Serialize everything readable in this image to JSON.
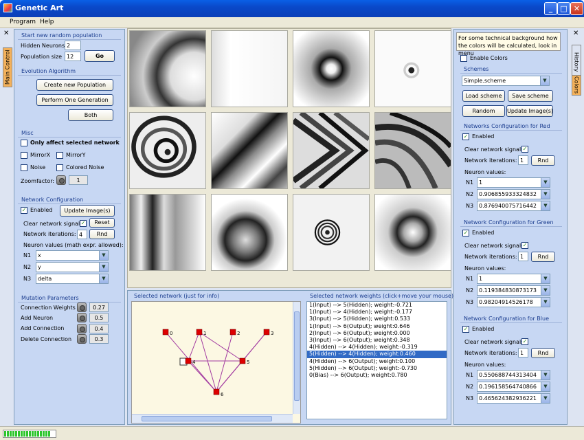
{
  "window": {
    "title": "Genetic Art",
    "min": "_",
    "max": "□",
    "close": "✕"
  },
  "menu": [
    "Program",
    "Help"
  ],
  "left_tabs": {
    "close": "✕",
    "main": "Main Control"
  },
  "right_tabs": {
    "close": "✕",
    "history": "History",
    "colors": "Colors"
  },
  "random_pop": {
    "title": "Start new random population",
    "hidden_label": "Hidden Neurons",
    "hidden_value": "2",
    "size_label": "Population size",
    "size_value": "12",
    "go": "Go"
  },
  "evolution": {
    "title": "Evolution Algorithm",
    "create": "Create new Population",
    "perform": "Perform One Generation",
    "both": "Both"
  },
  "misc": {
    "title": "Misc",
    "only_affect": "Only affect selected network",
    "mirrorx": "MirrorX",
    "mirrory": "MirrorY",
    "noise": "Noise",
    "colored_noise": "Colored Noise",
    "zoom_label": "Zoomfactor:",
    "zoom_value": "1"
  },
  "netconf": {
    "title": "Network Configuration",
    "enabled": "Enabled",
    "update": "Update Image(s)",
    "clear": "Clear network signals",
    "reset": "Reset",
    "iter_label": "Network iterations:",
    "iter_value": "4",
    "rnd": "Rnd",
    "neuron_label": "Neuron values (math expr. allowed):",
    "n": [
      {
        "label": "N1",
        "value": "x"
      },
      {
        "label": "N2",
        "value": "y"
      },
      {
        "label": "N3",
        "value": "delta"
      }
    ]
  },
  "mutation": {
    "title": "Mutation Parameters",
    "rows": [
      {
        "label": "Connection Weights",
        "value": "0.27"
      },
      {
        "label": "Add Neuron",
        "value": "0.5"
      },
      {
        "label": "Add Connection",
        "value": "0.4"
      },
      {
        "label": "Delete Connection",
        "value": "0.3"
      }
    ]
  },
  "network_view": {
    "title": "Selected network (just for info)",
    "nodes": [
      {
        "label": "0"
      },
      {
        "label": "1"
      },
      {
        "label": "2"
      },
      {
        "label": "3"
      },
      {
        "label": "4"
      },
      {
        "label": "5"
      },
      {
        "label": "6"
      }
    ]
  },
  "weights": {
    "title": "Selected network weights (click+move your mouse)",
    "items": [
      "1(Input) --> 5(Hidden); weight:-0.721",
      "1(Input) --> 4(Hidden); weight:-0.177",
      "3(Input) --> 5(Hidden); weight:0.533",
      "1(Input) --> 6(Output); weight:0.646",
      "2(Input) --> 6(Output); weight:0.000",
      "3(Input) --> 6(Output); weight:0.348",
      "4(Hidden) --> 4(Hidden); weight:-0.319",
      "5(Hidden) --> 4(Hidden); weight:0.460",
      "4(Hidden) --> 6(Output); weight:0.100",
      "5(Hidden) --> 6(Output); weight:-0.730",
      "0(Bias) --> 6(Output); weight:0.780"
    ],
    "selected": 7
  },
  "colors": {
    "info": "For some technical background how the colors will be calculated, look in menu",
    "enable": "Enable Colors",
    "schemes_title": "Schemes",
    "scheme": "Simple.scheme",
    "load": "Load scheme",
    "save": "Save scheme",
    "random": "Random",
    "update": "Update Image(s)",
    "channels": [
      {
        "title": "Networks Configuration for Red",
        "enabled": "Enabled",
        "clear": "Clear network signals",
        "iter_label": "Network iterations:",
        "iter_value": "1",
        "rnd": "Rnd",
        "neuron_label": "Neuron values:",
        "n": [
          {
            "label": "N1",
            "value": "1"
          },
          {
            "label": "N2",
            "value": "0.906855933324832"
          },
          {
            "label": "N3",
            "value": "0.876940075716442"
          }
        ]
      },
      {
        "title": "Network Configuration for Green",
        "enabled": "Enabled",
        "clear": "Clear network signals",
        "iter_label": "Network iterations:",
        "iter_value": "1",
        "rnd": "Rnd",
        "neuron_label": "Neuron values:",
        "n": [
          {
            "label": "N1",
            "value": "1"
          },
          {
            "label": "N2",
            "value": "0.119384830873173"
          },
          {
            "label": "N3",
            "value": "0.98204914526178"
          }
        ]
      },
      {
        "title": "Network Configuration for Blue",
        "enabled": "Enabled",
        "clear": "Clear network signals",
        "iter_label": "Network iterations:",
        "iter_value": "1",
        "rnd": "Rnd",
        "neuron_label": "Neuron values:",
        "n": [
          {
            "label": "N1",
            "value": "0.550688744313404"
          },
          {
            "label": "N2",
            "value": "0.196158564740866"
          },
          {
            "label": "N3",
            "value": "0.465624382936221"
          }
        ]
      }
    ]
  },
  "checkmark": "✓",
  "arrow_down": "▼",
  "progress_segments": 17
}
